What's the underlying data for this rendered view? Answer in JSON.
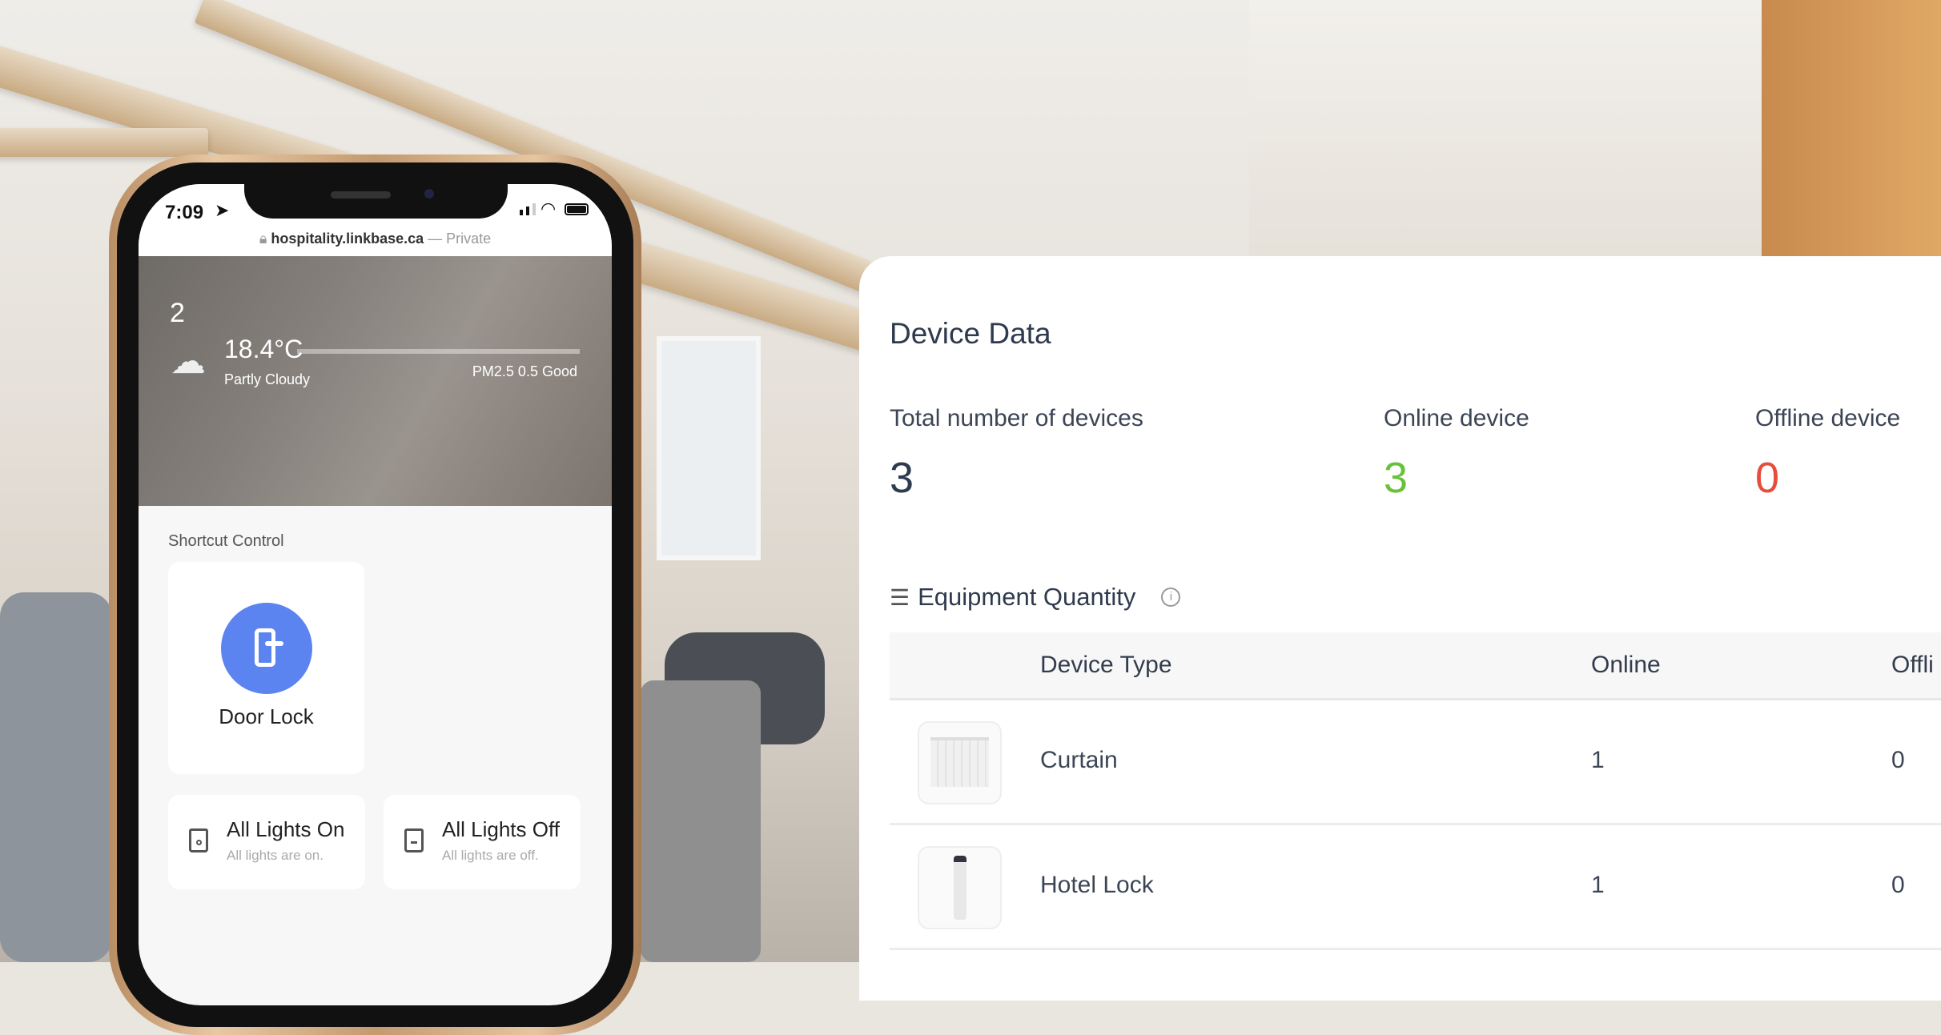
{
  "phone": {
    "status_time": "7:09",
    "url": "hospitality.linkbase.ca",
    "url_suffix": "— Private",
    "room_number": "2",
    "temperature": "18.4°C",
    "weather": "Partly Cloudy",
    "air_quality": "PM2.5 0.5 Good",
    "shortcut_title": "Shortcut Control",
    "door_lock_label": "Door Lock",
    "lights_on": {
      "title": "All Lights On",
      "subtitle": "All lights are on."
    },
    "lights_off": {
      "title": "All Lights Off",
      "subtitle": "All lights are off."
    },
    "accent": "#5b84f1"
  },
  "dashboard": {
    "title": "Device Data",
    "stats": [
      {
        "label": "Total number of devices",
        "value": "3",
        "color": "#2e3a4d"
      },
      {
        "label": "Online device",
        "value": "3",
        "color": "#67c23a"
      },
      {
        "label": "Offline device",
        "value": "0",
        "color": "#e74c3c"
      }
    ],
    "section_title": "Equipment Quantity",
    "columns": [
      "Device Type",
      "Online",
      "Offli"
    ],
    "rows": [
      {
        "type": "Curtain",
        "online": "1",
        "offline": "0"
      },
      {
        "type": "Hotel Lock",
        "online": "1",
        "offline": "0"
      }
    ]
  }
}
